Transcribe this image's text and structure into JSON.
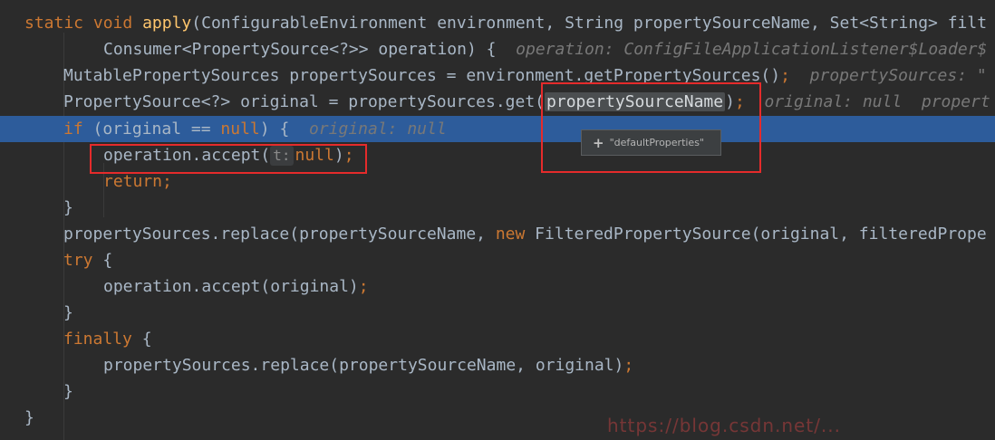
{
  "code": {
    "l1": {
      "kw1": "static",
      "kw2": "void",
      "method": "apply",
      "rest": "(ConfigurableEnvironment environment, String propertySourceName, Set<String> filt"
    },
    "l2": {
      "text": "Consumer<PropertySource<?>> operation) {",
      "hint": "operation: ConfigFileApplicationListener$Loader$"
    },
    "l3": {
      "text": "MutablePropertySources propertySources = environment.getPropertySources()",
      "semi": ";",
      "hint": "propertySources: \""
    },
    "l4": {
      "pre": "PropertySource<?> original = propertySources.get(",
      "highlight": "propertySourceName",
      "post": ")",
      "semi": ";",
      "hint": "original: null  propert"
    },
    "l5": {
      "kw": "if",
      "mid": " (original == ",
      "kw_null": "null",
      "post": ") {",
      "hint": "original: null"
    },
    "l6": {
      "pre": "operation.accept(",
      "param_hint": "t:",
      "kw_null": "null",
      "post": ")",
      "semi": ";"
    },
    "l7": {
      "kw": "return",
      "semi": ";"
    },
    "l8": {
      "text": "}"
    },
    "l9": {
      "pre": "propertySources.replace(propertySourceName, ",
      "kw": "new",
      "post": " FilteredPropertySource(original, filteredPrope"
    },
    "l10": {
      "kw": "try",
      "post": " {"
    },
    "l11": {
      "text": "operation.accept(original)",
      "semi": ";"
    },
    "l12": {
      "text": "}"
    },
    "l13": {
      "kw": "finally",
      "post": " {"
    },
    "l14": {
      "text": "propertySources.replace(propertySourceName, original)",
      "semi": ";"
    },
    "l15": {
      "text": "}"
    },
    "l16": {
      "text": "}"
    }
  },
  "tooltip": {
    "icon": "plus-icon",
    "value": "\"defaultProperties\""
  },
  "watermark": "https://blog.csdn.net/...",
  "colors": {
    "background": "#2b2b2b",
    "current_line": "#2d5c9b",
    "keyword": "#cc7832",
    "method": "#ffc66d",
    "annotation_box": "#e52b2b"
  }
}
